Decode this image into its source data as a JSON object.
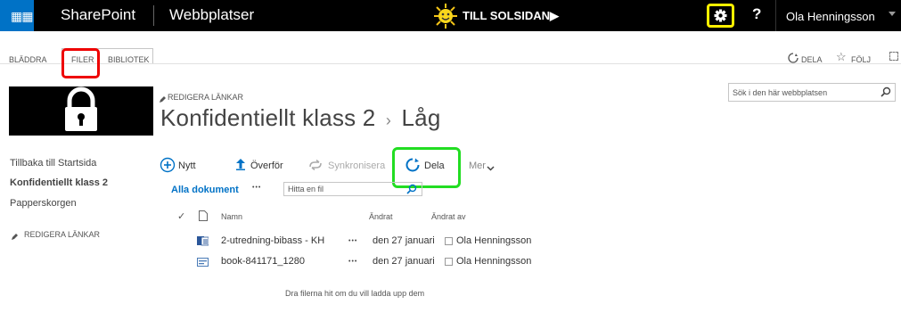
{
  "suite": {
    "brand": "SharePoint",
    "sites": "Webbplatser",
    "logo_text": "TILL SOLSIDAN▶",
    "help": "?",
    "user": "Ola Henningsson"
  },
  "ribbon": {
    "tabs": [
      "BLÄDDRA",
      "FILER",
      "BIBLIOTEK"
    ],
    "share": "DELA",
    "follow": "FÖLJ"
  },
  "page": {
    "edit_links_top": "REDIGERA LÄNKAR",
    "title": "Konfidentiellt klass 2",
    "breadcrumb_sep": "›",
    "subtitle": "Låg",
    "search_placeholder": "Sök i den här webbplatsen"
  },
  "nav": {
    "items": [
      "Tillbaka till Startsida",
      "Konfidentiellt klass 2",
      "Papperskorgen"
    ],
    "edit_links": "REDIGERA LÄNKAR"
  },
  "toolbar": {
    "new": "Nytt",
    "upload": "Överför",
    "sync": "Synkronisera",
    "share": "Dela",
    "more": "Mer"
  },
  "views": {
    "all": "Alla dokument",
    "more": "•••",
    "find_placeholder": "Hitta en fil"
  },
  "table": {
    "columns": [
      "Namn",
      "Ändrat",
      "Ändrat av"
    ],
    "rows": [
      {
        "name": "2-utredning-bibass - KH",
        "menu": "•••",
        "modified": "den 27 januari",
        "modified_by": "Ola Henningsson"
      },
      {
        "name": "book-841171_1280",
        "menu": "•••",
        "modified": "den 27 januari",
        "modified_by": "Ola Henningsson"
      }
    ],
    "drop_hint": "Dra filerna hit om du vill ladda upp dem"
  },
  "colors": {
    "suite_bar": "#000000",
    "accent": "#0072c6",
    "highlight_red": "#e00000",
    "highlight_yellow": "#ffef00",
    "highlight_green": "#22dd22"
  }
}
